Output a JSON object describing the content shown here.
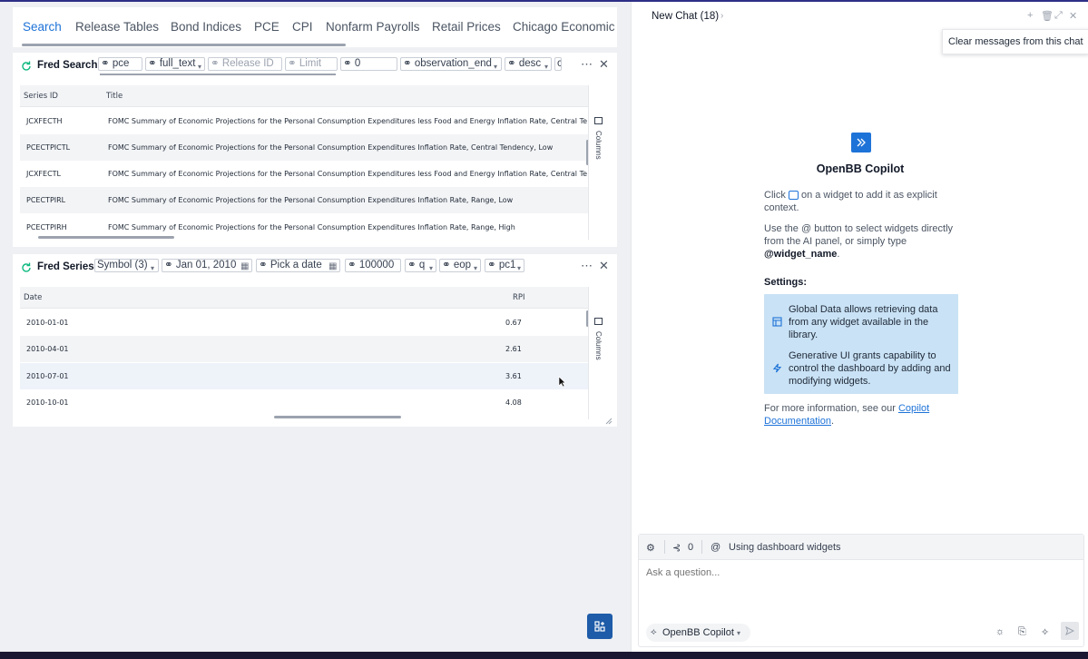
{
  "tabs": [
    "Search",
    "Release Tables",
    "Bond Indices",
    "PCE",
    "CPI",
    "Nonfarm Payrolls",
    "Retail Prices",
    "Chicago Economic C"
  ],
  "active_tab": "Search",
  "fred_search": {
    "title": "Fred Search",
    "params": {
      "query": "pce",
      "search_type": "full_text",
      "release_id_placeholder": "Release ID",
      "limit_placeholder": "Limit",
      "offset": "0",
      "order_by": "observation_end",
      "sort_order": "desc",
      "more": "c"
    },
    "columns": [
      "Series ID",
      "Title"
    ],
    "rows": [
      {
        "id": "JCXFECTH",
        "title": "FOMC Summary of Economic Projections for the Personal Consumption Expenditures less Food and Energy Inflation Rate, Central Te"
      },
      {
        "id": "PCECTPICTL",
        "title": "FOMC Summary of Economic Projections for the Personal Consumption Expenditures Inflation Rate, Central Tendency, Low"
      },
      {
        "id": "JCXFECTL",
        "title": "FOMC Summary of Economic Projections for the Personal Consumption Expenditures less Food and Energy Inflation Rate, Central Te"
      },
      {
        "id": "PCECTPIRL",
        "title": "FOMC Summary of Economic Projections for the Personal Consumption Expenditures Inflation Rate, Range, Low"
      },
      {
        "id": "PCECTPIRH",
        "title": "FOMC Summary of Economic Projections for the Personal Consumption Expenditures Inflation Rate, Range, High"
      }
    ],
    "columns_label": "Columns"
  },
  "fred_series": {
    "title": "Fred Series",
    "params": {
      "symbol": "Symbol (3)",
      "start_date": "Jan 01, 2010",
      "end_date": "Pick a date",
      "limit": "100000",
      "frequency": "q",
      "aggregation": "eop",
      "transform": "pc1"
    },
    "columns": [
      "Date",
      "RPI"
    ],
    "rows": [
      {
        "date": "2010-01-01",
        "value": "0.67"
      },
      {
        "date": "2010-04-01",
        "value": "2.61"
      },
      {
        "date": "2010-07-01",
        "value": "3.61"
      },
      {
        "date": "2010-10-01",
        "value": "4.08"
      }
    ],
    "columns_label": "Columns"
  },
  "chat": {
    "title": "New Chat (18)",
    "tooltip": "Clear messages from this chat",
    "copilot_title": "OpenBB Copilot",
    "intro_before": "Click",
    "intro_after": "on a widget to add it as explicit context.",
    "use_text": "Use the @ button to select widgets directly from the AI panel, or simply type",
    "widget_name": "@widget_name",
    "settings_label": "Settings:",
    "settings": [
      "Global Data allows retrieving data from any widget available in the library.",
      "Generative UI grants capability to control the dashboard by adding and modifying widgets."
    ],
    "more_info_text": "For more information, see our",
    "more_info_link": "Copilot Documentation",
    "composer": {
      "count": "0",
      "context": "Using dashboard widgets",
      "placeholder": "Ask a question...",
      "model": "OpenBB Copilot"
    }
  },
  "colors": {
    "accent": "#1e73d8",
    "settings_bg": "#c9e2f5",
    "add_button": "#1e5ba8"
  }
}
